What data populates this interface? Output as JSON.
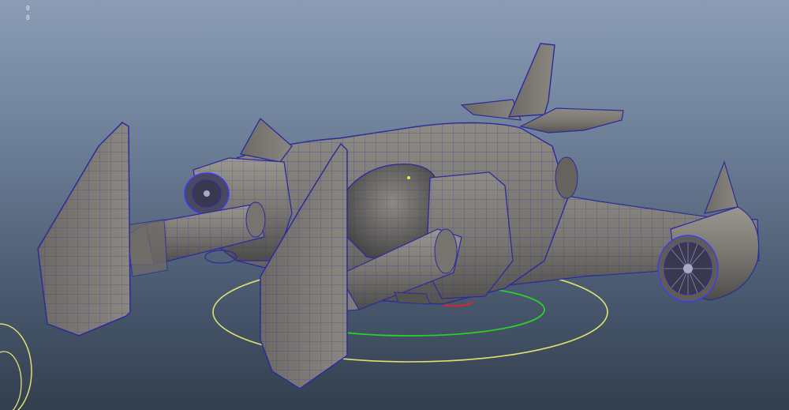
{
  "viewport": {
    "hud_lines": [
      "0",
      "0"
    ],
    "background_colors": {
      "top": "#8b9cb5",
      "bottom": "#333f4f"
    }
  },
  "scene": {
    "model": "vtol-gunship-wireframe-on-shaded",
    "colors": {
      "mesh_fill": "#77746f",
      "mesh_shadow": "#4f4d4a",
      "wire": "#2d2a9c",
      "selection_ring": "#e0e070",
      "green_manipulator": "#2bd02b",
      "red_manipulator": "#d22a2a",
      "engine_highlight": "#3a3aff"
    }
  }
}
